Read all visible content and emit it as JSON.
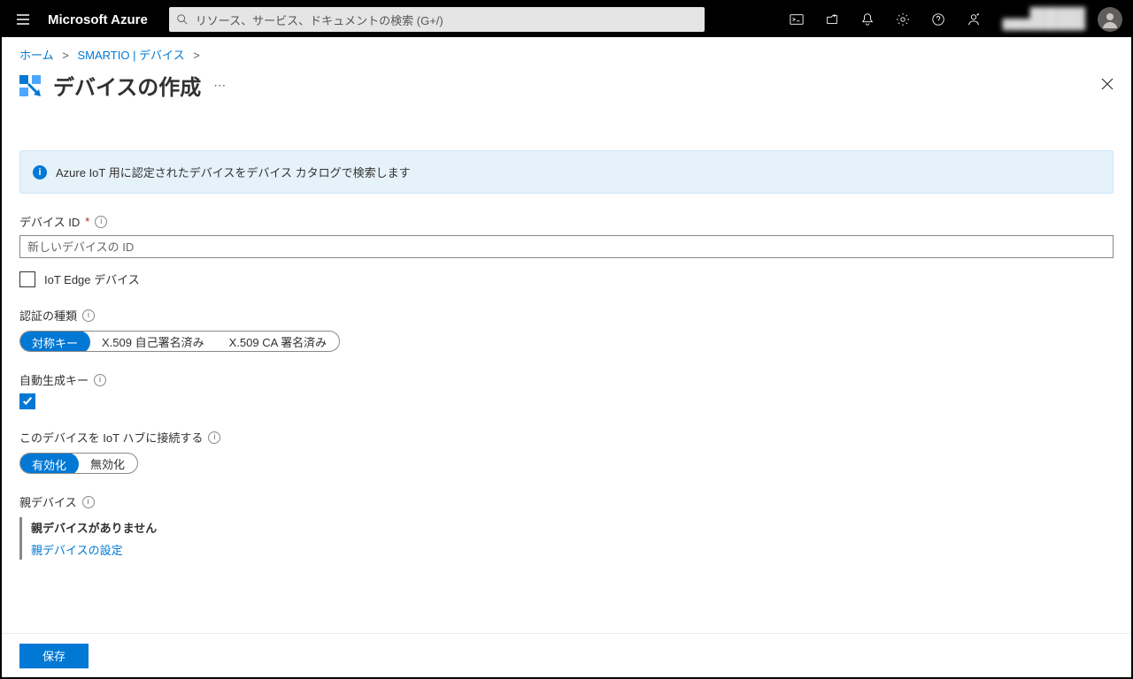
{
  "topbar": {
    "brand": "Microsoft Azure",
    "search_placeholder": "リソース、サービス、ドキュメントの検索 (G+/)",
    "account_line1": "████████",
    "account_line2": "████████████"
  },
  "breadcrumb": {
    "home": "ホーム",
    "resource": "SMARTIO | デバイス"
  },
  "page": {
    "title": "デバイスの作成",
    "banner": "Azure IoT 用に認定されたデバイスをデバイス カタログで検索します"
  },
  "fields": {
    "device_id_label": "デバイス ID",
    "device_id_placeholder": "新しいデバイスの ID",
    "iot_edge_label": "IoT Edge デバイス",
    "auth_type_label": "認証の種類",
    "auth_options": {
      "sym": "対称キー",
      "x509self": "X.509 自己署名済み",
      "x509ca": "X.509 CA 署名済み"
    },
    "auto_key_label": "自動生成キー",
    "connect_label": "このデバイスを IoT ハブに接続する",
    "connect_options": {
      "enable": "有効化",
      "disable": "無効化"
    },
    "parent_label": "親デバイス",
    "parent_none": "親デバイスがありません",
    "parent_link": "親デバイスの設定"
  },
  "footer": {
    "save": "保存"
  }
}
